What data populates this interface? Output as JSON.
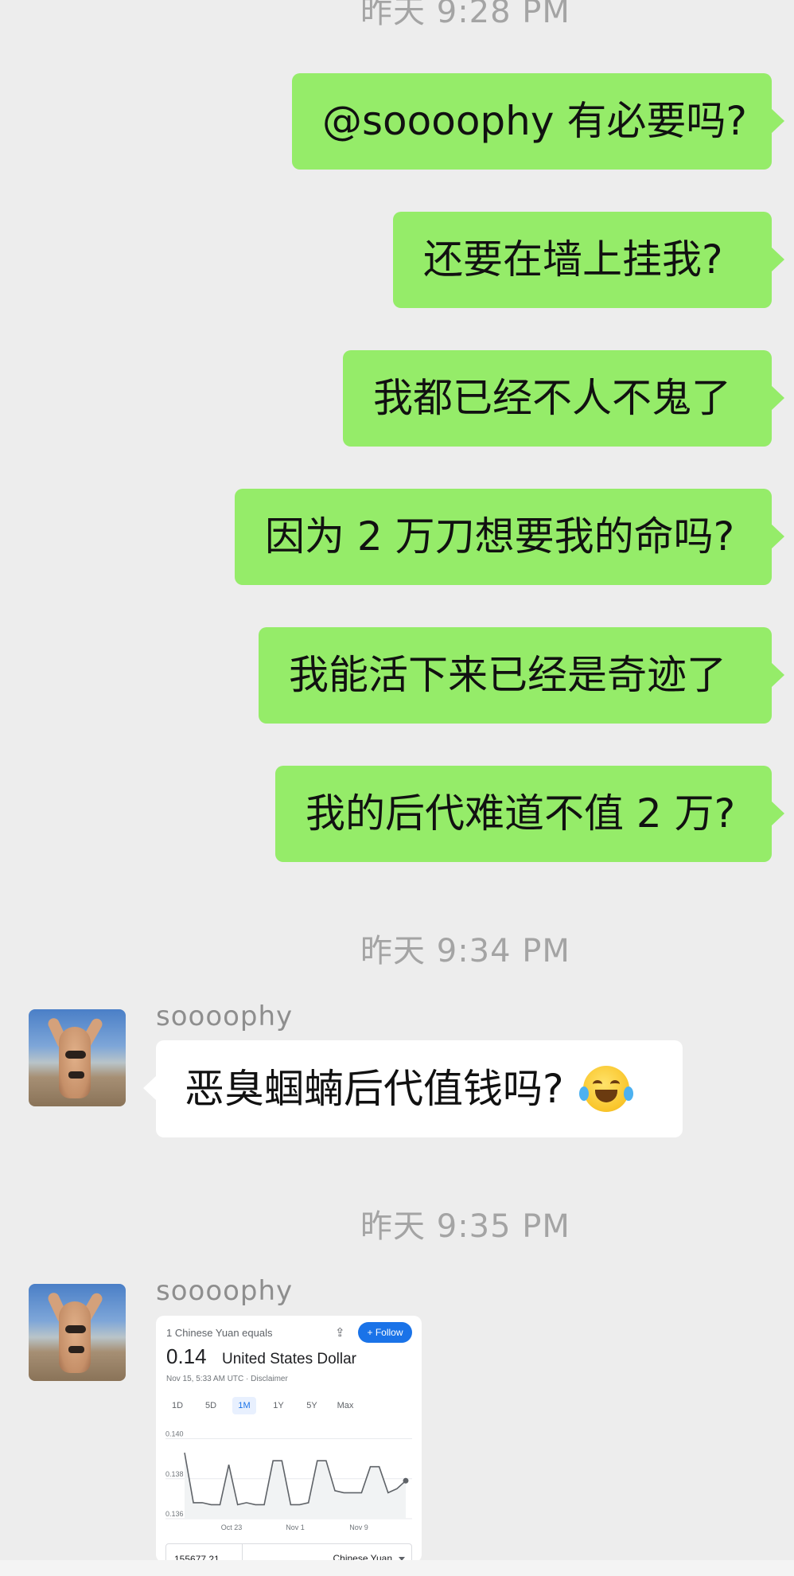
{
  "timestamps": [
    "昨天 9:28 PM",
    "昨天 9:34 PM",
    "昨天 9:35 PM"
  ],
  "outgoing": [
    "@soooophy 有必要吗?",
    "还要在墙上挂我?",
    "我都已经不人不鬼了",
    "因为 2 万刀想要我的命吗?",
    "我能活下来已经是奇迹了",
    "我的后代难道不值 2 万?"
  ],
  "sender": {
    "name": "soooophy",
    "avatar_icon": "avatar-photo"
  },
  "incoming": [
    {
      "text": "恶臭蝈蝻后代值钱吗?",
      "emoji": "tears-of-joy-emoji"
    }
  ],
  "finance_card": {
    "equals_label": "1 Chinese Yuan equals",
    "follow_label": "+ Follow",
    "rate": "0.14",
    "currency": "United States Dollar",
    "date": "Nov 15, 5:33 AM UTC · Disclaimer",
    "ranges": [
      "1D",
      "5D",
      "1M",
      "1Y",
      "5Y",
      "Max"
    ],
    "selected_range": "1M",
    "amount": "155677.21",
    "amount_currency": "Chinese Yuan",
    "accent_color": "#1a73e8",
    "chart_data": {
      "type": "line",
      "y_ticks": [
        "0.140",
        "0.138",
        "0.136"
      ],
      "x_ticks": [
        "Oct 23",
        "Nov 1",
        "Nov 9"
      ],
      "ylim": [
        0.136,
        0.1405
      ],
      "y": [
        0.1393,
        0.1368,
        0.1368,
        0.1367,
        0.1367,
        0.1387,
        0.1367,
        0.1368,
        0.1367,
        0.1367,
        0.1389,
        0.1389,
        0.1367,
        0.1367,
        0.1368,
        0.1389,
        0.1389,
        0.1374,
        0.1373,
        0.1373,
        0.1373,
        0.1386,
        0.1386,
        0.1373,
        0.1375,
        0.1379
      ]
    }
  }
}
